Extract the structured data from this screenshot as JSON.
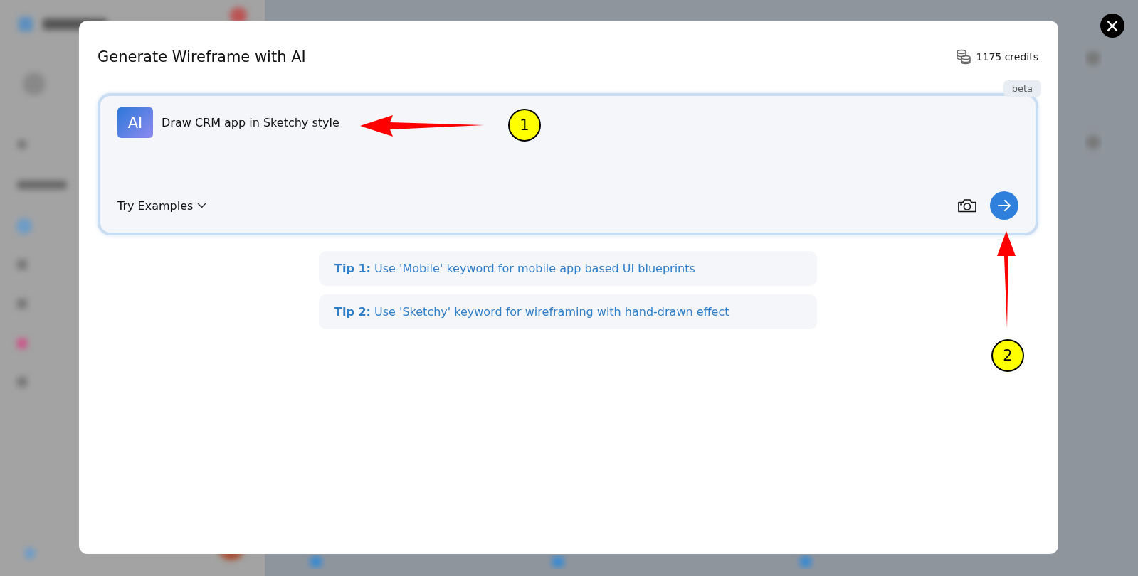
{
  "dialog": {
    "title": "Generate Wireframe with AI",
    "credits": "1175 credits",
    "close_label": "×"
  },
  "prompt": {
    "badge": "beta",
    "icon_label": "AI",
    "value": "Draw CRM app in Sketchy style",
    "examples_label": "Try Examples"
  },
  "tips": [
    {
      "text": "**Tip 1:** Use 'Mobile' keyword for mobile app based UI blueprints"
    },
    {
      "text": "**Tip 2:** Use 'Sketchy' keyword for wireframing with hand-drawn effect"
    }
  ],
  "annotations": [
    {
      "number": "1"
    },
    {
      "number": "2"
    }
  ]
}
